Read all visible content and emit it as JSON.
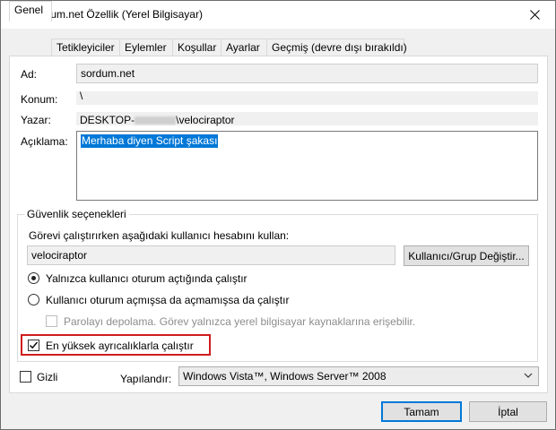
{
  "window": {
    "title": "sordum.net Özellik (Yerel Bilgisayar)",
    "icons": {
      "app": "clock-icon",
      "close": "close-icon"
    }
  },
  "tabs": [
    {
      "label": "Genel",
      "active": true
    },
    {
      "label": "Tetikleyiciler"
    },
    {
      "label": "Eylemler"
    },
    {
      "label": "Koşullar"
    },
    {
      "label": "Ayarlar"
    },
    {
      "label": "Geçmiş (devre dışı bırakıldı)"
    }
  ],
  "general": {
    "name_label": "Ad:",
    "name_value": "sordum.net",
    "location_label": "Konum:",
    "location_value": "\\",
    "author_label": "Yazar:",
    "author_prefix": "DESKTOP-",
    "author_suffix": "\\velociraptor",
    "description_label": "Açıklama:",
    "description_value": "Merhaba diyen Script şakası"
  },
  "security": {
    "group_title": "Güvenlik seçenekleri",
    "run_as_label": "Görevi çalıştırırken aşağıdaki kullanıcı hesabını kullan:",
    "user_value": "velociraptor",
    "change_user_button": "Kullanıcı/Grup Değiştir...",
    "radio_logged_on": "Yalnızca kullanıcı oturum açtığında çalıştır",
    "radio_whether": "Kullanıcı oturum açmışsa da açmamışsa da çalıştır",
    "do_not_store_password": "Parolayı depolama. Görev yalnızca yerel bilgisayar kaynaklarına erişebilir.",
    "highest_privileges": "En yüksek ayrıcalıklarla çalıştır"
  },
  "bottom": {
    "hidden_label": "Gizli",
    "configure_label": "Yapılandır:",
    "configure_value": "Windows Vista™, Windows Server™ 2008"
  },
  "buttons": {
    "ok": "Tamam",
    "cancel": "İptal"
  },
  "state": {
    "radio_logged_on_selected": true,
    "highest_privileges_checked": true,
    "hidden_checked": false,
    "do_not_store_password_enabled": false
  },
  "colors": {
    "highlight": "#d01d1d",
    "selection": "#0078d7"
  }
}
